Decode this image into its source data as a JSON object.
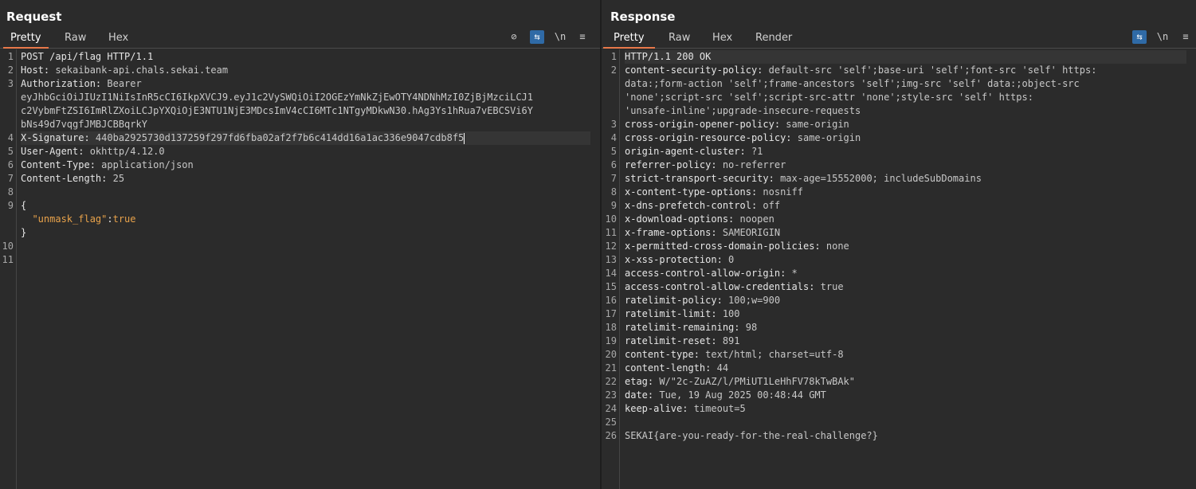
{
  "request": {
    "title": "Request",
    "tabs": [
      "Pretty",
      "Raw",
      "Hex"
    ],
    "active_tab": "Pretty",
    "tools": {
      "hide": "hide-icon",
      "wrap": "wrap-icon",
      "newline": "\\n",
      "menu": "menu-icon"
    },
    "line_numbers": [
      "1",
      "2",
      "3",
      "",
      "",
      "",
      "4",
      "5",
      "6",
      "7",
      "8",
      "9",
      "",
      "",
      "10",
      "11"
    ],
    "lines": {
      "l1": "POST /api/flag HTTP/1.1",
      "l2k": "Host:",
      "l2v": " sekaibank-api.chals.sekai.team",
      "l3k": "Authorization:",
      "l3v": " Bearer",
      "l3a": "eyJhbGciOiJIUzI1NiIsInR5cCI6IkpXVCJ9.eyJ1c2VySWQiOiI2OGEzYmNkZjEwOTY4NDNhMzI0ZjBjMzciLCJ1",
      "l3b": "c2VybmFtZSI6ImRlZXoiLCJpYXQiOjE3NTU1NjE3MDcsImV4cCI6MTc1NTgyMDkwN30.hAg3Ys1hRua7vEBCSVi6Y",
      "l3c": "bNs49d7vqgfJMBJCBBqrkY",
      "l4k": "X-Signature:",
      "l4v": " 440ba2925730d137259f297fd6fba02af2f7b6c414dd16a1ac336e9047cdb8f5",
      "l5k": "User-Agent:",
      "l5v": " okhttp/4.12.0",
      "l6k": "Content-Type:",
      "l6v": " application/json",
      "l7k": "Content-Length:",
      "l7v": " 25",
      "l9a": "{",
      "l9key": "\"unmask_flag\"",
      "l9colon": ":",
      "l9val": "true",
      "l9c": "}"
    }
  },
  "response": {
    "title": "Response",
    "tabs": [
      "Pretty",
      "Raw",
      "Hex",
      "Render"
    ],
    "active_tab": "Pretty",
    "tools": {
      "wrap": "wrap-icon",
      "newline": "\\n",
      "menu": "menu-icon"
    },
    "line_numbers": [
      "1",
      "2",
      "",
      "",
      "",
      "3",
      "4",
      "5",
      "6",
      "7",
      "8",
      "9",
      "10",
      "11",
      "12",
      "13",
      "14",
      "15",
      "16",
      "17",
      "18",
      "19",
      "20",
      "21",
      "22",
      "23",
      "24",
      "25",
      "26"
    ],
    "headers": [
      {
        "k": "HTTP/1.1 200 OK",
        "v": ""
      },
      {
        "k": "content-security-policy:",
        "v": " default-src 'self';base-uri 'self';font-src 'self' https:"
      },
      {
        "k": "",
        "v": "data:;form-action 'self';frame-ancestors 'self';img-src 'self' data:;object-src"
      },
      {
        "k": "",
        "v": "'none';script-src 'self';script-src-attr 'none';style-src 'self' https:"
      },
      {
        "k": "",
        "v": "'unsafe-inline';upgrade-insecure-requests"
      },
      {
        "k": "cross-origin-opener-policy:",
        "v": " same-origin"
      },
      {
        "k": "cross-origin-resource-policy:",
        "v": " same-origin"
      },
      {
        "k": "origin-agent-cluster:",
        "v": " ?1"
      },
      {
        "k": "referrer-policy:",
        "v": " no-referrer"
      },
      {
        "k": "strict-transport-security:",
        "v": " max-age=15552000; includeSubDomains"
      },
      {
        "k": "x-content-type-options:",
        "v": " nosniff"
      },
      {
        "k": "x-dns-prefetch-control:",
        "v": " off"
      },
      {
        "k": "x-download-options:",
        "v": " noopen"
      },
      {
        "k": "x-frame-options:",
        "v": " SAMEORIGIN"
      },
      {
        "k": "x-permitted-cross-domain-policies:",
        "v": " none"
      },
      {
        "k": "x-xss-protection:",
        "v": " 0"
      },
      {
        "k": "access-control-allow-origin:",
        "v": " *"
      },
      {
        "k": "access-control-allow-credentials:",
        "v": " true"
      },
      {
        "k": "ratelimit-policy:",
        "v": " 100;w=900"
      },
      {
        "k": "ratelimit-limit:",
        "v": " 100"
      },
      {
        "k": "ratelimit-remaining:",
        "v": " 98"
      },
      {
        "k": "ratelimit-reset:",
        "v": " 891"
      },
      {
        "k": "content-type:",
        "v": " text/html; charset=utf-8"
      },
      {
        "k": "content-length:",
        "v": " 44"
      },
      {
        "k": "etag:",
        "v": " W/\"2c-ZuAZ/l/PMiUT1LeHhFV78kTwBAk\""
      },
      {
        "k": "date:",
        "v": " Tue, 19 Aug 2025 00:48:44 GMT"
      },
      {
        "k": "keep-alive:",
        "v": " timeout=5"
      },
      {
        "k": "",
        "v": ""
      },
      {
        "k": "",
        "v": "SEKAI{are-you-ready-for-the-real-challenge?}"
      }
    ]
  },
  "colors": {
    "accent": "#e8784a",
    "toggle_on": "#2f6aa6",
    "json_string": "#e8a24a"
  }
}
